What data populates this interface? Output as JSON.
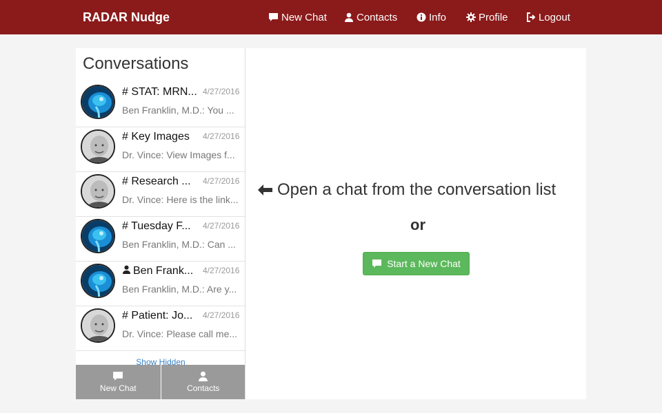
{
  "brand": "RADAR Nudge",
  "nav": [
    {
      "label": "New Chat",
      "icon": "chat-icon"
    },
    {
      "label": "Contacts",
      "icon": "user-icon"
    },
    {
      "label": "Info",
      "icon": "info-icon"
    },
    {
      "label": "Profile",
      "icon": "gear-icon"
    },
    {
      "label": "Logout",
      "icon": "logout-icon"
    }
  ],
  "sidebar": {
    "title": "Conversations",
    "show_hidden": "Show Hidden",
    "conversations": [
      {
        "prefix": "#",
        "title": "STAT: MRN...",
        "date": "4/27/2016",
        "preview": "Ben Franklin, M.D.: You ...",
        "avatar": "mri-avatar"
      },
      {
        "prefix": "#",
        "title": "Key Images",
        "date": "4/27/2016",
        "preview": "Dr. Vince: View Images f...",
        "avatar": "person-avatar"
      },
      {
        "prefix": "#",
        "title": "Research ...",
        "date": "4/27/2016",
        "preview": "Dr. Vince: Here is the link...",
        "avatar": "person-avatar"
      },
      {
        "prefix": "#",
        "title": "Tuesday F...",
        "date": "4/27/2016",
        "preview": "Ben Franklin, M.D.: Can ...",
        "avatar": "mri-avatar"
      },
      {
        "prefix": "",
        "title": "Ben Frank...",
        "date": "4/27/2016",
        "preview": "Ben Franklin, M.D.: Are y...",
        "avatar": "mri-avatar",
        "direct": true
      },
      {
        "prefix": "#",
        "title": "Patient: Jo...",
        "date": "4/27/2016",
        "preview": "Dr. Vince: Please call me...",
        "avatar": "person-avatar"
      }
    ],
    "bottom": [
      {
        "label": "New Chat",
        "icon": "chat-icon"
      },
      {
        "label": "Contacts",
        "icon": "user-icon"
      }
    ]
  },
  "main": {
    "hint": "Open a chat from the conversation list",
    "or": "or",
    "start_button": "Start a New Chat"
  },
  "colors": {
    "navbar": "#8b1a1a",
    "start_button": "#5cb85c",
    "bottom_bar": "#9a9a9a",
    "link": "#3b82c4"
  }
}
